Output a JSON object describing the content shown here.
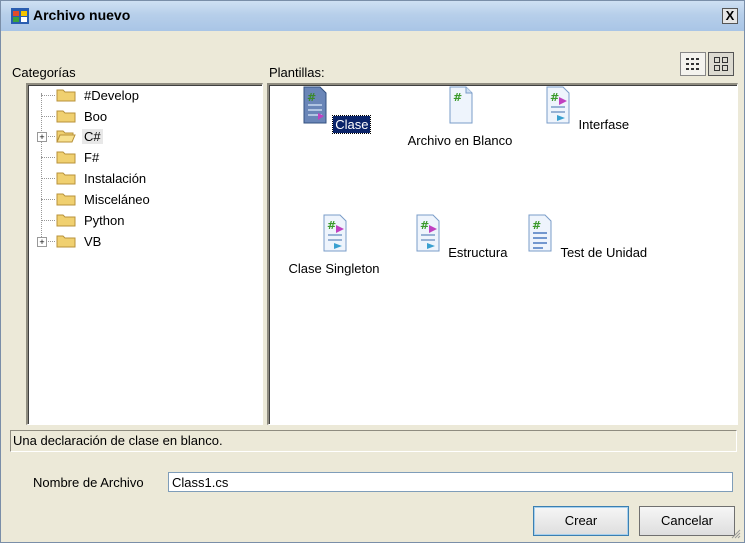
{
  "window": {
    "title": "Archivo nuevo",
    "close_label": "X"
  },
  "categories": {
    "label": "Categorías",
    "items": [
      {
        "label": "#Develop",
        "expandable": false,
        "selected": false
      },
      {
        "label": "Boo",
        "expandable": false,
        "selected": false
      },
      {
        "label": "C#",
        "expandable": true,
        "selected": true,
        "open": true
      },
      {
        "label": "F#",
        "expandable": false,
        "selected": false
      },
      {
        "label": "Instalación",
        "expandable": false,
        "selected": false
      },
      {
        "label": "Misceláneo",
        "expandable": false,
        "selected": false
      },
      {
        "label": "Python",
        "expandable": false,
        "selected": false
      },
      {
        "label": "VB",
        "expandable": true,
        "selected": false
      }
    ]
  },
  "templates": {
    "label": "Plantillas:",
    "items": [
      {
        "label": "Clase",
        "icon": "class-file-icon",
        "selected": true
      },
      {
        "label": "Archivo en Blanco",
        "icon": "blank-file-icon",
        "selected": false
      },
      {
        "label": "Interfase",
        "icon": "interface-file-icon",
        "selected": false
      },
      {
        "label": "Clase Singleton",
        "icon": "singleton-file-icon",
        "selected": false
      },
      {
        "label": "Estructura",
        "icon": "struct-file-icon",
        "selected": false
      },
      {
        "label": "Test de Unidad",
        "icon": "unit-test-file-icon",
        "selected": false
      }
    ],
    "view_buttons": [
      "list-view-icon",
      "large-icons-view-icon"
    ]
  },
  "description": "Una declaración de clase en blanco.",
  "filename": {
    "label": "Nombre de Archivo",
    "value": "Class1.cs"
  },
  "buttons": {
    "create": "Crear",
    "cancel": "Cancelar"
  },
  "colors": {
    "selection": "#0a246a",
    "window_bg": "#ece9d8",
    "titlebar": "#b7cfea"
  }
}
